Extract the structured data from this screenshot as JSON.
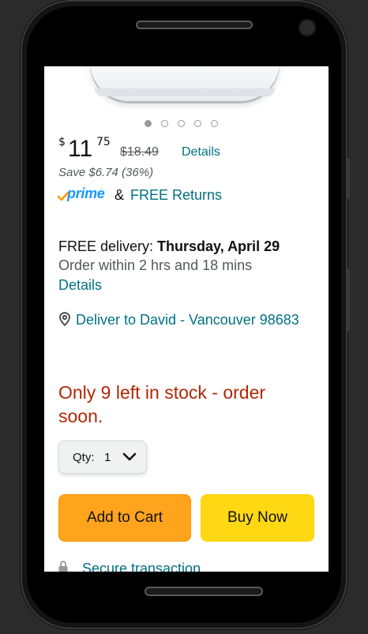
{
  "carousel": {
    "dot_count": 5,
    "active_index": 0
  },
  "price": {
    "currency": "$",
    "whole": "11",
    "fraction": "75",
    "list_price": "$18.49",
    "details_label": "Details",
    "savings": "Save $6.74 (36%)"
  },
  "prime": {
    "logo_text": "prime",
    "amp": "&",
    "free_returns": "FREE Returns"
  },
  "delivery": {
    "prefix": "FREE delivery: ",
    "date": "Thursday, April 29",
    "order_within": "Order within 2 hrs and 18 mins",
    "details_label": "Details",
    "deliver_to": "Deliver to David - Vancouver 98683"
  },
  "stock": {
    "message": "Only 9 left in stock - order soon."
  },
  "quantity": {
    "label": "Qty:",
    "value": "1"
  },
  "buttons": {
    "add_to_cart": "Add to Cart",
    "buy_now": "Buy Now"
  },
  "secure": {
    "label": "Secure transaction"
  },
  "colors": {
    "link": "#007185",
    "stock_warning": "#b12704",
    "add_to_cart_bg": "#ffa41c",
    "buy_now_bg": "#ffd814",
    "prime_blue": "#1a98ff",
    "prime_check": "#ff9900"
  },
  "icons": {
    "location": "location-pin-icon",
    "chevron": "chevron-down-icon",
    "lock": "lock-icon"
  }
}
